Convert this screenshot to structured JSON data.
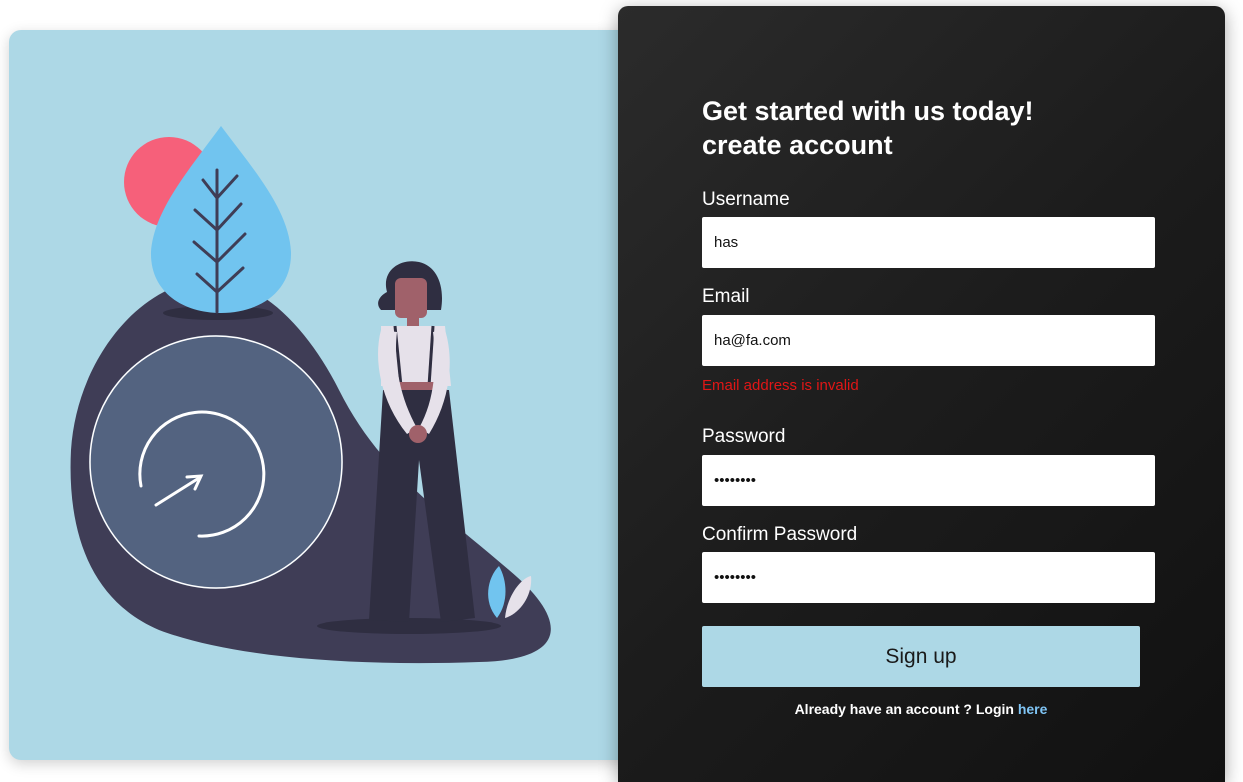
{
  "form": {
    "heading_line1": "Get started with us today!",
    "heading_line2": "create account",
    "username_label": "Username",
    "username_value": "has",
    "email_label": "Email",
    "email_value": "ha@fa.com",
    "email_error": "Email address is invalid",
    "password_label": "Password",
    "password_value": "12345678",
    "confirm_label": "Confirm Password",
    "confirm_value": "12345678",
    "signup_label": "Sign up",
    "login_prompt": "Already have an account ? Login",
    "login_link": "here"
  },
  "colors": {
    "left_background": "#add8e6",
    "panel_background": "#1c1c1c",
    "button_background": "#add8e6",
    "error": "#e01616",
    "link": "#7fc4f4",
    "sun": "#f6607a",
    "leaf": "#71c4ef",
    "blob": "#3f3d56",
    "circle": "#536380"
  },
  "icons": [
    "sun-icon",
    "leaf-icon",
    "refresh-arrow-icon",
    "person-figure",
    "small-leaf-icon"
  ]
}
